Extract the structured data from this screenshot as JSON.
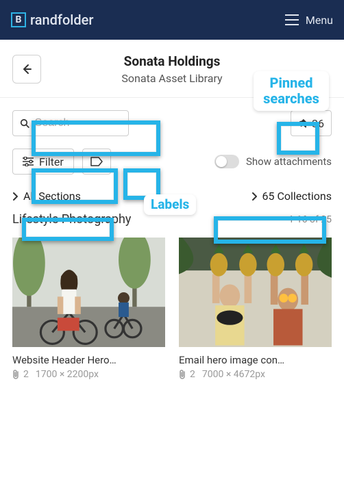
{
  "header": {
    "logo_text": "randfolder",
    "menu_label": "Menu"
  },
  "title": {
    "org": "Sonata Holdings",
    "library": "Sonata Asset Library"
  },
  "toolbar": {
    "search_placeholder": "Search",
    "pin_count": "36",
    "filter_label": "Filter",
    "show_attachments_label": "Show attachments"
  },
  "nav": {
    "all_sections": "All Sections",
    "collections": "65 Collections"
  },
  "section": {
    "name": "Lifestyle Photography",
    "range": "1-16 of 25"
  },
  "assets": [
    {
      "title": "Website Header Hero…",
      "attachments": "2",
      "dimensions": "1700 × 2200px"
    },
    {
      "title": "Email hero image con…",
      "attachments": "2",
      "dimensions": "7000 × 4672px"
    }
  ],
  "callouts": {
    "pinned_searches": "Pinned searches",
    "labels": "Labels"
  }
}
